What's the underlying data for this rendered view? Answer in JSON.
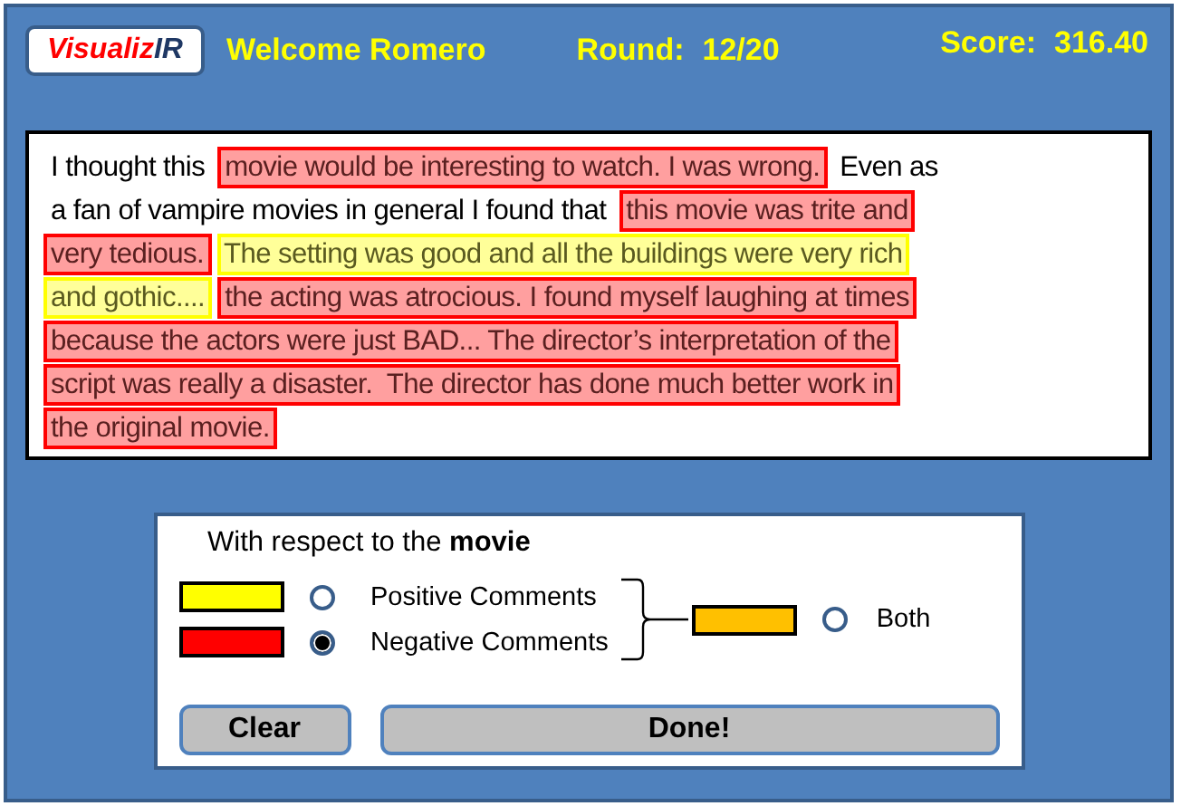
{
  "header": {
    "logo": [
      "Visualiz",
      "IR"
    ],
    "welcome": "Welcome Romero",
    "round_label": "Round:",
    "round": "12/20",
    "score_label": "Score:",
    "score": "316.40"
  },
  "passage": [
    [
      {
        "kind": "plain",
        "text": "I thought this"
      },
      {
        "kind": "negative",
        "text": "movie would be interesting to watch. I was wrong."
      },
      {
        "kind": "plain",
        "text": "Even as"
      }
    ],
    [
      {
        "kind": "plain",
        "text": "a fan of vampire movies in general I found that"
      },
      {
        "kind": "negative",
        "text": "this movie was trite and"
      }
    ],
    [
      {
        "kind": "negative",
        "text": "very tedious."
      },
      {
        "kind": "positive",
        "text": "The setting was good and all the buildings were very rich"
      }
    ],
    [
      {
        "kind": "positive",
        "text": "and gothic...."
      },
      {
        "kind": "negative",
        "text": "the acting was atrocious. I found myself laughing at times"
      }
    ],
    [
      {
        "kind": "negative",
        "text": "because the actors were just BAD... The director’s interpretation of the"
      }
    ],
    [
      {
        "kind": "negative",
        "text": "script was really a disaster.  The director has done much better work in"
      }
    ],
    [
      {
        "kind": "negative",
        "text": "the original movie."
      }
    ]
  ],
  "legend": {
    "heading": "With respect to the **movie**",
    "options": [
      {
        "label": "Positive Comments",
        "color": "#ffff00",
        "selected": false
      },
      {
        "label": "Negative Comments",
        "color": "#ff0000",
        "selected": true
      }
    ],
    "both": {
      "label": "Both",
      "color": "#ffc000",
      "selected": false
    }
  },
  "buttons": [
    "Clear",
    "Done!"
  ]
}
